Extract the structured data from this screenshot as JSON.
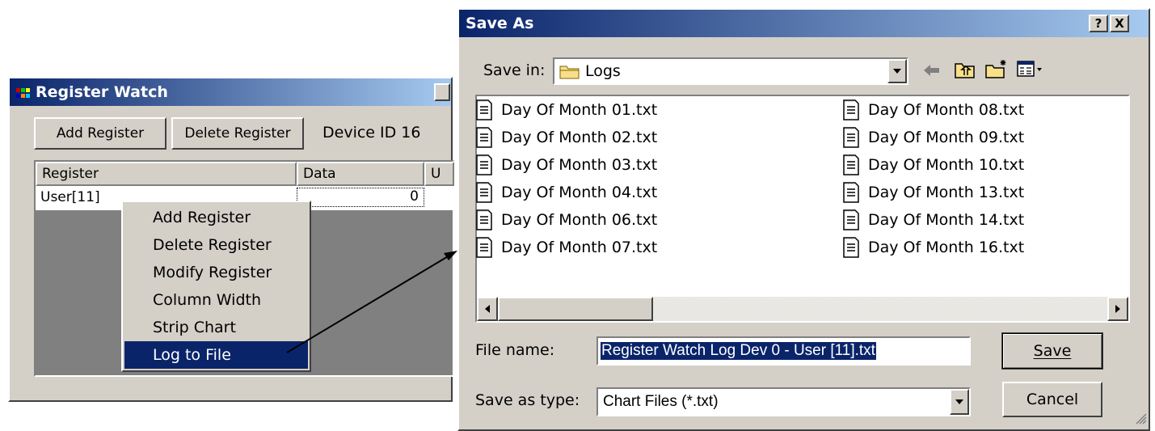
{
  "register_watch": {
    "title": "Register Watch",
    "toolbar": {
      "add_register": "Add Register",
      "delete_register": "Delete Register",
      "device_id": "Device ID 16"
    },
    "columns": [
      "Register",
      "Data",
      "U"
    ],
    "rows": [
      {
        "register": "User[11]",
        "data": "0"
      }
    ],
    "context_menu": {
      "items": [
        "Add Register",
        "Delete Register",
        "Modify Register",
        "Column Width",
        "Strip Chart",
        "Log to File"
      ],
      "selected": "Log to File"
    }
  },
  "save_as": {
    "title": "Save As",
    "help_button": "?",
    "close_button": "X",
    "save_in_label": "Save in:",
    "save_in_value": "Logs",
    "files": [
      "Day Of Month 01.txt",
      "Day Of Month 02.txt",
      "Day Of Month 03.txt",
      "Day Of Month 04.txt",
      "Day Of Month 06.txt",
      "Day Of Month 07.txt",
      "Day Of Month 08.txt",
      "Day Of Month 09.txt",
      "Day Of Month 10.txt",
      "Day Of Month 13.txt",
      "Day Of Month 14.txt",
      "Day Of Month 16.txt"
    ],
    "file_name_label": "File name:",
    "file_name_value": "Register Watch Log Dev 0 - User [11].txt",
    "save_type_label": "Save as type:",
    "save_type_value": "Chart Files (*.txt)",
    "save_button": "Save",
    "cancel_button": "Cancel"
  },
  "colors": {
    "title_start": "#0a246a",
    "title_end": "#a6caf0",
    "face": "#d4d0c8",
    "selection": "#0a246a"
  }
}
